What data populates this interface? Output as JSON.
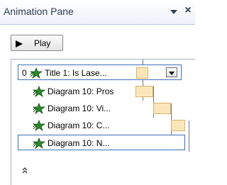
{
  "pane": {
    "title": "Animation Pane",
    "menu_icon": "dropdown-arrow-icon",
    "close_icon": "close-icon",
    "close_glyph": "×"
  },
  "play_button": {
    "label": "Play",
    "icon": "play-triangle-icon"
  },
  "animation_list": {
    "items": [
      {
        "index": "0",
        "label": "Title 1: Is Lase...",
        "icon": "entrance-star-icon",
        "effect_color": "#2a8a2a",
        "selected": true
      },
      {
        "index": "",
        "label": "Diagram 10: Pros",
        "icon": "entrance-star-icon",
        "effect_color": "#2a8a2a",
        "selected": false
      },
      {
        "index": "",
        "label": "Diagram 10: Vi...",
        "icon": "entrance-star-icon",
        "effect_color": "#2a8a2a",
        "selected": false
      },
      {
        "index": "",
        "label": "Diagram 10: C...",
        "icon": "entrance-star-icon",
        "effect_color": "#2a8a2a",
        "selected": false
      },
      {
        "index": "",
        "label": "Diagram 10: N...",
        "icon": "entrance-star-icon",
        "effect_color": "#2a8a2a",
        "selected": false
      }
    ],
    "collapse_icon": "double-chevron-up-icon"
  },
  "colors": {
    "selection_border": "#3d6fb6",
    "timing_fill": "#fbe6b9",
    "timing_border": "#d7b36a",
    "header_text": "#2f3f57"
  }
}
